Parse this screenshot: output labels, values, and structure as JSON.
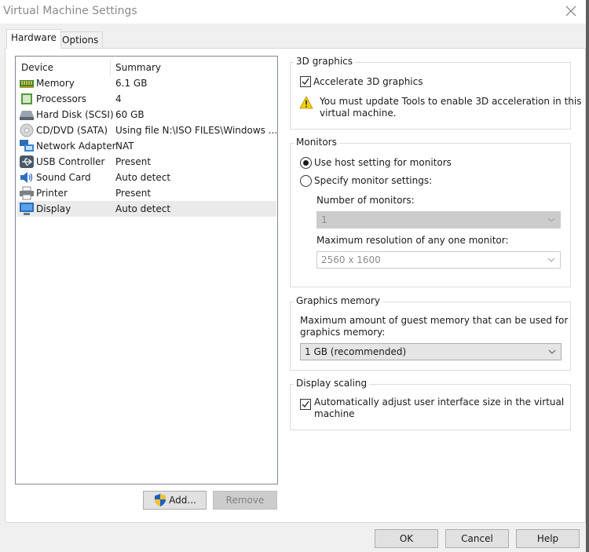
{
  "window": {
    "title": "Virtual Machine Settings",
    "close_icon": "close-icon"
  },
  "tabs": [
    {
      "label": "Hardware",
      "active": true
    },
    {
      "label": "Options",
      "active": false
    }
  ],
  "device_list": {
    "headers": {
      "device": "Device",
      "summary": "Summary"
    },
    "rows": [
      {
        "icon": "memory-icon",
        "device": "Memory",
        "summary": "6.1 GB"
      },
      {
        "icon": "processor-icon",
        "device": "Processors",
        "summary": "4"
      },
      {
        "icon": "hard-disk-icon",
        "device": "Hard Disk (SCSI)",
        "summary": "60 GB"
      },
      {
        "icon": "cd-dvd-icon",
        "device": "CD/DVD (SATA)",
        "summary": "Using file N:\\ISO FILES\\Windows ..."
      },
      {
        "icon": "network-adapter-icon",
        "device": "Network Adapter",
        "summary": "NAT"
      },
      {
        "icon": "usb-icon",
        "device": "USB Controller",
        "summary": "Present"
      },
      {
        "icon": "sound-card-icon",
        "device": "Sound Card",
        "summary": "Auto detect"
      },
      {
        "icon": "printer-icon",
        "device": "Printer",
        "summary": "Present"
      },
      {
        "icon": "display-icon",
        "device": "Display",
        "summary": "Auto detect",
        "selected": true
      }
    ],
    "add_button": "Add...",
    "remove_button": "Remove"
  },
  "graphics_3d": {
    "title": "3D graphics",
    "accelerate_label": "Accelerate 3D graphics",
    "accelerate_checked": true,
    "warning_line1": "You must update Tools to enable 3D acceleration in this",
    "warning_line2": "virtual machine."
  },
  "monitors": {
    "title": "Monitors",
    "use_host_label": "Use host setting for monitors",
    "specify_label": "Specify monitor settings:",
    "selected_option": "use_host",
    "number_label": "Number of monitors:",
    "number_value": "1",
    "max_res_label": "Maximum resolution of any one monitor:",
    "max_res_value": "2560 x 1600"
  },
  "graphics_memory": {
    "title": "Graphics memory",
    "desc_line1": "Maximum amount of guest memory that can be used for",
    "desc_line2": "graphics memory:",
    "value": "1 GB (recommended)"
  },
  "display_scaling": {
    "title": "Display scaling",
    "auto_adjust_line1": "Automatically adjust user interface size in the virtual",
    "auto_adjust_line2": "machine",
    "auto_adjust_checked": true
  },
  "footer": {
    "ok": "OK",
    "cancel": "Cancel",
    "help": "Help"
  }
}
